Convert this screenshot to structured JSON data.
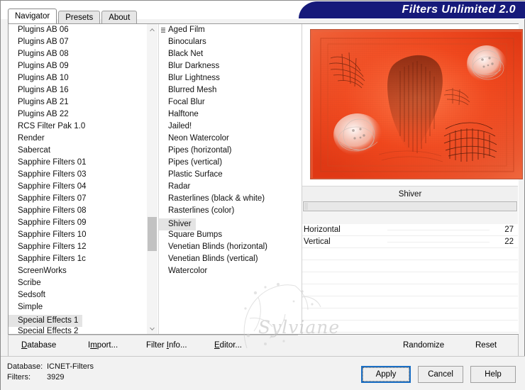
{
  "window": {
    "title": "Filters Unlimited 2.0",
    "title_bg": "#161a7a",
    "title_fg": "#ffffff"
  },
  "tabs": [
    {
      "label": "Navigator",
      "active": true
    },
    {
      "label": "Presets",
      "active": false
    },
    {
      "label": "About",
      "active": false
    }
  ],
  "categories": {
    "selected": "Special Effects 1",
    "items": [
      "Plugins AB 06",
      "Plugins AB 07",
      "Plugins AB 08",
      "Plugins AB 09",
      "Plugins AB 10",
      "Plugins AB 16",
      "Plugins AB 21",
      "Plugins AB 22",
      "RCS Filter Pak 1.0",
      "Render",
      "Sabercat",
      "Sapphire Filters 01",
      "Sapphire Filters 03",
      "Sapphire Filters 04",
      "Sapphire Filters 07",
      "Sapphire Filters 08",
      "Sapphire Filters 09",
      "Sapphire Filters 10",
      "Sapphire Filters 12",
      "Sapphire Filters 1c",
      "ScreenWorks",
      "Scribe",
      "Sedsoft",
      "Simple",
      "Special Effects 1",
      "Special Effects 2"
    ]
  },
  "filters": {
    "selected": "Shiver",
    "items": [
      "Aged Film",
      "Binoculars",
      "Black Net",
      "Blur Darkness",
      "Blur Lightness",
      "Blurred Mesh",
      "Focal Blur",
      "Halftone",
      "Jailed!",
      "Neon Watercolor",
      "Pipes (horizontal)",
      "Pipes (vertical)",
      "Plastic Surface",
      "Radar",
      "Rasterlines (black & white)",
      "Rasterlines (color)",
      "Shiver",
      "Square Bumps",
      "Venetian Blinds (horizontal)",
      "Venetian Blinds (vertical)",
      "Watercolor"
    ]
  },
  "preview": {
    "accent": "#e8441f",
    "border": "#b9563a"
  },
  "params": {
    "header": "Shiver",
    "rows": [
      {
        "name": "Horizontal",
        "value": "27"
      },
      {
        "name": "Vertical",
        "value": "22"
      }
    ],
    "empty_rows": 7
  },
  "watermark": {
    "text": "Sylviane"
  },
  "actionbar": {
    "buttons": [
      {
        "pre": "",
        "key": "D",
        "post": "atabase"
      },
      {
        "pre": "I",
        "key": "m",
        "post": "port..."
      },
      {
        "pre": "Filter ",
        "key": "I",
        "post": "nfo..."
      },
      {
        "pre": "",
        "key": "E",
        "post": "ditor..."
      }
    ],
    "randomize_label": "Randomize",
    "reset_label": "Reset"
  },
  "status": {
    "database_label": "Database:",
    "database_value": "ICNET-Filters",
    "filters_label": "Filters:",
    "filters_value": "3929"
  },
  "dialog_buttons": {
    "apply": "Apply",
    "cancel": "Cancel",
    "help": "Help"
  }
}
